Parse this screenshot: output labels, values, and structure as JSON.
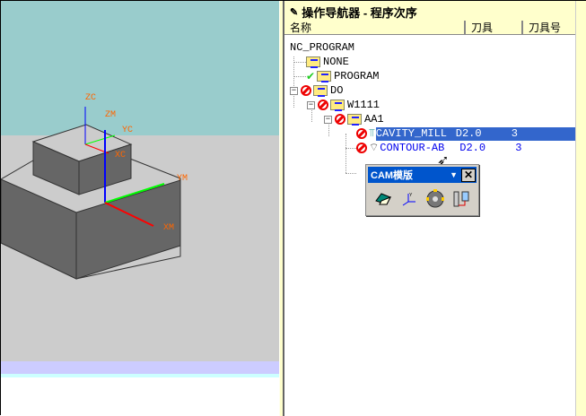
{
  "viewport": {
    "axis_labels": {
      "zc": "ZC",
      "zm": "ZM",
      "yc": "YC",
      "xc": "XC",
      "ym": "YM",
      "xm": "XM"
    }
  },
  "navigator": {
    "title": "操作导航器 - 程序次序",
    "columns": [
      "名称",
      "刀具",
      "刀具号"
    ],
    "tree": [
      {
        "name": "NC_PROGRAM"
      },
      {
        "name": "NONE"
      },
      {
        "name": "PROGRAM",
        "status": "check"
      },
      {
        "name": "DO",
        "status": "blocked"
      },
      {
        "name": "W1111",
        "status": "blocked"
      },
      {
        "name": "AA1",
        "status": "blocked"
      },
      {
        "name": "CAVITY_MILL",
        "tool": "D2.0",
        "tool_no": "3",
        "status": "blocked",
        "selected": true
      },
      {
        "name": "CONTOUR-AB",
        "tool": "D2.0",
        "tool_no": "3",
        "status": "blocked"
      }
    ],
    "selection_color": "#3366cc"
  },
  "cam_toolbar": {
    "title": "CAM模版",
    "close": "✕",
    "dropdown": "▼",
    "icons": [
      "geometry-icon",
      "coordinate-system-icon",
      "mill-tool-icon",
      "tool-holder-icon"
    ]
  }
}
